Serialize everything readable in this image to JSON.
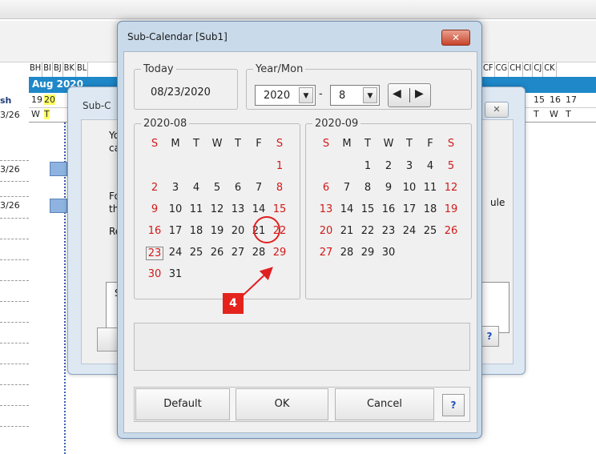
{
  "background": {
    "columns_left": [
      "BH",
      "BI",
      "BJ",
      "BK",
      "BL"
    ],
    "columns_right": [
      "CF",
      "CG",
      "CH",
      "CI",
      "CJ",
      "CK"
    ],
    "month_label": "Aug 2020",
    "days_left": [
      "19",
      "20"
    ],
    "days_right": [
      "15",
      "16",
      "17"
    ],
    "dow_left": [
      "W",
      "T"
    ],
    "dow_right": [
      "T",
      "W",
      "T"
    ],
    "row_labels": [
      "sh",
      "3/26",
      "3/26",
      "3/26"
    ]
  },
  "back_dialog": {
    "title": "Sub-C",
    "close_label": "✕",
    "text_lines": [
      "You",
      "cale",
      "For",
      "tha",
      "Reg",
      "S"
    ],
    "right_text": "ule",
    "help_label": "?"
  },
  "dialog": {
    "title": "Sub-Calendar [Sub1]",
    "close_label": "✕",
    "today": {
      "legend": "Today",
      "value": "08/23/2020"
    },
    "year_mon": {
      "legend": "Year/Mon",
      "year": "2020",
      "month": "8",
      "separator": "-",
      "prev": "◀",
      "next": "▶"
    },
    "weekdays": [
      "S",
      "M",
      "T",
      "W",
      "T",
      "F",
      "S"
    ],
    "months": [
      {
        "legend": "2020-08",
        "weeks": [
          [
            "",
            "",
            "",
            "",
            "",
            "",
            "1"
          ],
          [
            "2",
            "3",
            "4",
            "5",
            "6",
            "7",
            "8"
          ],
          [
            "9",
            "10",
            "11",
            "12",
            "13",
            "14",
            "15"
          ],
          [
            "16",
            "17",
            "18",
            "19",
            "20",
            "21",
            "22"
          ],
          [
            "23",
            "24",
            "25",
            "26",
            "27",
            "28",
            "29"
          ],
          [
            "30",
            "31",
            "",
            "",
            "",
            "",
            ""
          ]
        ],
        "red_days": [
          "1",
          "2",
          "8",
          "9",
          "15",
          "16",
          "22",
          "23",
          "29",
          "30"
        ]
      },
      {
        "legend": "2020-09",
        "weeks": [
          [
            "",
            "",
            "1",
            "2",
            "3",
            "4",
            "5"
          ],
          [
            "6",
            "7",
            "8",
            "9",
            "10",
            "11",
            "12"
          ],
          [
            "13",
            "14",
            "15",
            "16",
            "17",
            "18",
            "19"
          ],
          [
            "20",
            "21",
            "22",
            "23",
            "24",
            "25",
            "26"
          ],
          [
            "27",
            "28",
            "29",
            "30",
            "",
            "",
            ""
          ]
        ],
        "red_days": [
          "5",
          "6",
          "12",
          "13",
          "19",
          "20",
          "26",
          "27"
        ]
      }
    ],
    "buttons": {
      "default": "Default",
      "ok": "OK",
      "cancel": "Cancel",
      "help": "?"
    },
    "callout": "4"
  }
}
